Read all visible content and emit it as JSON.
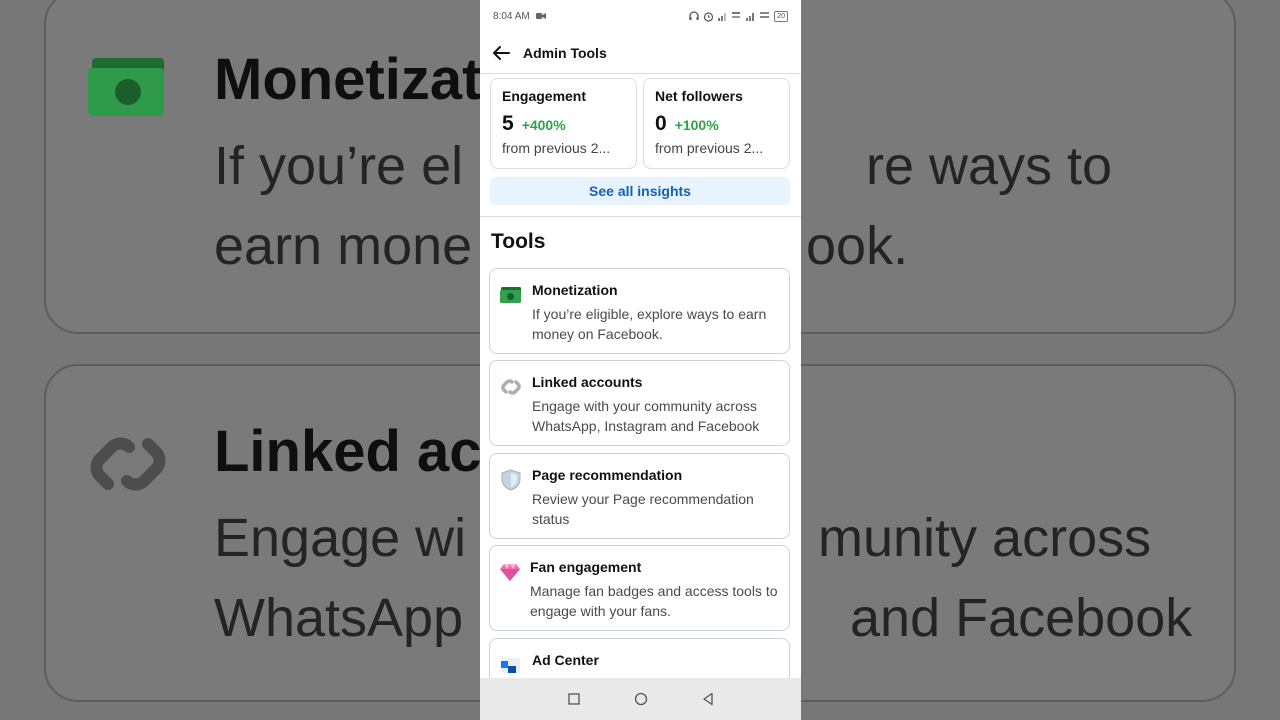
{
  "background": {
    "cards": [
      {
        "title": "Monetizat",
        "desc_lines": [
          "If you’re el",
          "earn mone"
        ],
        "right_lines": [
          "re ways to",
          "ook."
        ]
      },
      {
        "title": "Linked acc",
        "desc_lines": [
          "Engage wi",
          "WhatsApp"
        ],
        "right_lines": [
          "munity across",
          "and Facebook"
        ]
      }
    ]
  },
  "status_bar": {
    "time": "8:04 AM",
    "battery": "20"
  },
  "app_bar": {
    "title": "Admin Tools"
  },
  "stats": [
    {
      "label": "Engagement",
      "value": "5",
      "change": "+400%",
      "sub": "from previous 2..."
    },
    {
      "label": "Net followers",
      "value": "0",
      "change": "+100%",
      "sub": "from previous 2..."
    }
  ],
  "insights_button": "See all insights",
  "tools_section": {
    "title": "Tools",
    "items": [
      {
        "name": "Monetization",
        "desc": "If you’re eligible, explore ways to earn money on Facebook.",
        "icon": "money-icon"
      },
      {
        "name": "Linked accounts",
        "desc": "Engage with your community across WhatsApp, Instagram and Facebook",
        "icon": "link-icon"
      },
      {
        "name": "Page recommendation",
        "desc": "Review your Page recommendation status",
        "icon": "shield-icon"
      },
      {
        "name": "Fan engagement",
        "desc": "Manage fan badges and access tools to engage with your fans.",
        "icon": "diamond-icon"
      },
      {
        "name": "Ad Center",
        "desc": "",
        "icon": "ad-center-icon"
      }
    ]
  },
  "colors": {
    "positive": "#31a24c",
    "link": "#1360b8",
    "button_bg": "#e7f3ff"
  }
}
